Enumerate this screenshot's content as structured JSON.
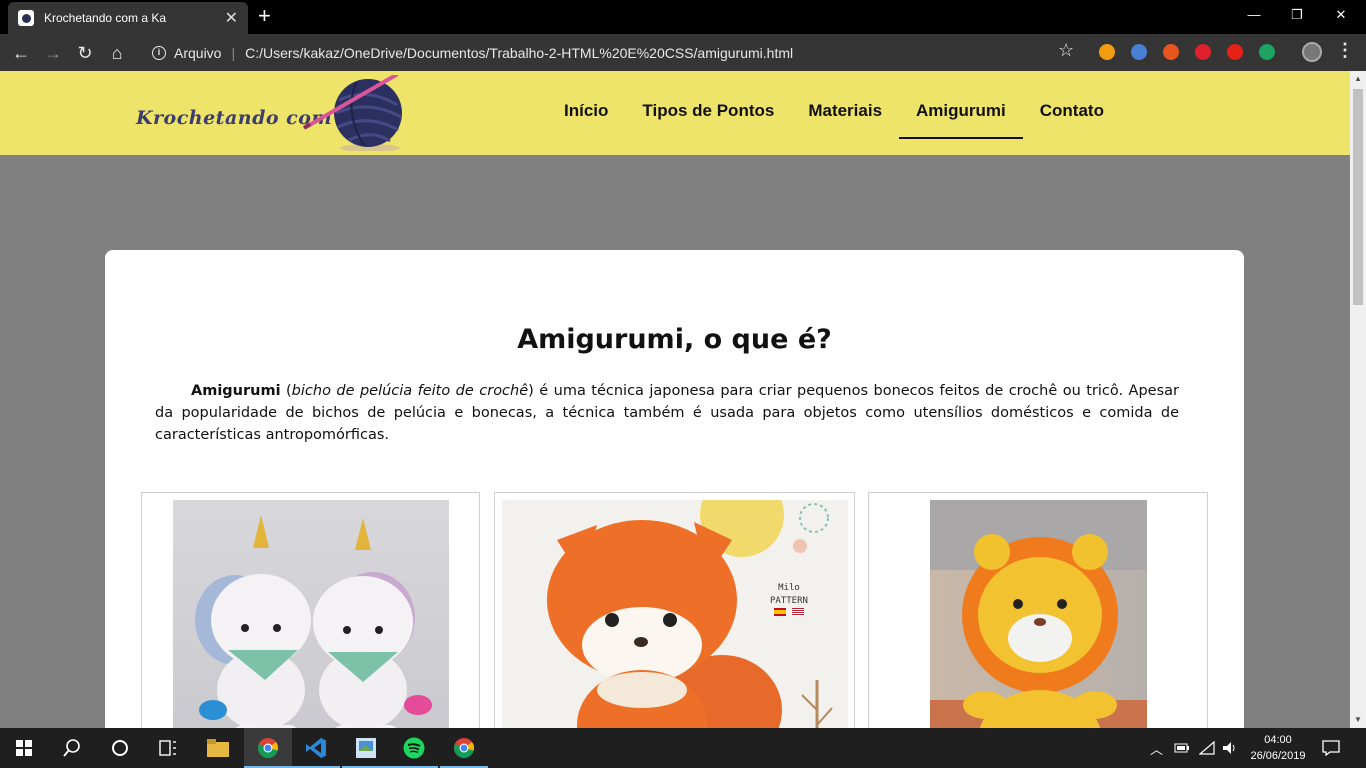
{
  "browser": {
    "tab_title": "Krochetando com a Ka",
    "tab_close": "✕",
    "new_tab": "+",
    "window_controls": {
      "minimize": "—",
      "restore": "❐",
      "close": "✕"
    },
    "nav": {
      "back": "←",
      "forward": "→",
      "reload": "↻",
      "home": "⌂"
    },
    "security_label": "Arquivo",
    "separator": "|",
    "url": "C:/Users/kakaz/OneDrive/Documentos/Trabalho-2-HTML%20E%20CSS/amigurumi.html",
    "bookmark_icon": "☆",
    "menu_icon": "⋮",
    "extensions": [
      {
        "name": "play-extension-icon",
        "color": "#f39c12"
      },
      {
        "name": "translate-extension-icon",
        "color": "#4a7fd6"
      },
      {
        "name": "fire-extension-icon",
        "color": "#e8541e"
      },
      {
        "name": "adblock-extension-icon",
        "color": "#e0202c"
      },
      {
        "name": "youtube-extension-icon",
        "color": "#e62117"
      },
      {
        "name": "green-extension-icon",
        "color": "#1da462"
      }
    ]
  },
  "site": {
    "logo_text": "Krochetando com a Ka",
    "nav": [
      {
        "label": "Início",
        "active": false
      },
      {
        "label": "Tipos de Pontos",
        "active": false
      },
      {
        "label": "Materiais",
        "active": false
      },
      {
        "label": "Amigurumi",
        "active": true
      },
      {
        "label": "Contato",
        "active": false
      }
    ],
    "colors": {
      "header_bg": "#efe46a",
      "page_bg": "#808080",
      "logo_color": "#3b3d6e"
    }
  },
  "content": {
    "title": "Amigurumi, o que é?",
    "intro_term": "Amigurumi",
    "intro_open_paren": " (",
    "intro_translation": "bicho de pelúcia feito de crochê",
    "intro_rest": ") é uma técnica japonesa para criar pequenos bonecos feitos de crochê ou tricô. Apesar da popularidade de bichos de pelúcia e bonecas, a técnica também é usada para objetos como utensílios domésticos e comida de características antropomórficas.",
    "gallery": [
      {
        "subject": "unicorns-photo"
      },
      {
        "subject": "fox-photo",
        "pattern_brand": "Milo",
        "pattern_label": "PATTERN"
      },
      {
        "subject": "lion-photo"
      }
    ]
  },
  "taskbar": {
    "time": "04:00",
    "date": "26/06/2019",
    "tray_chevron": "︿"
  }
}
